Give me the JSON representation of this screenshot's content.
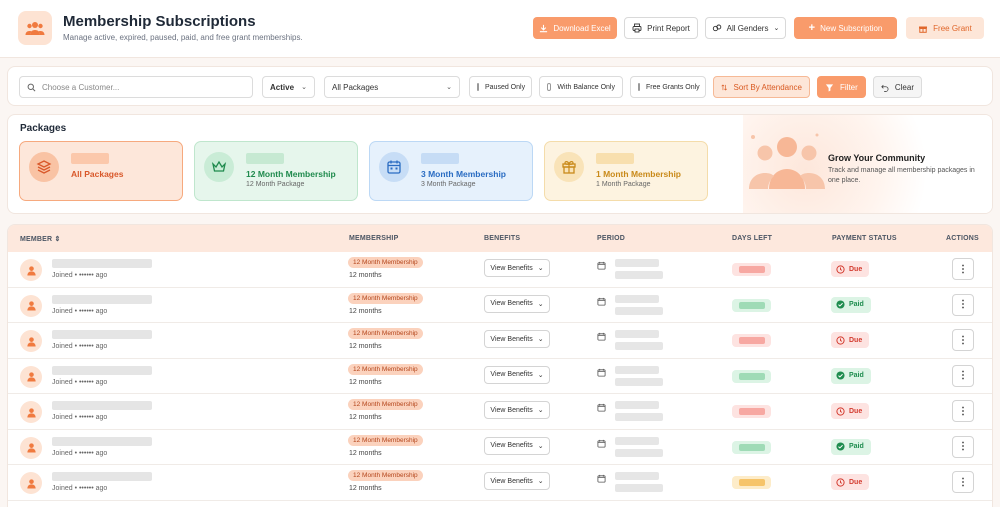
{
  "header": {
    "title": "Membership Subscriptions",
    "subtitle": "Manage active, expired, paused, paid, and free grant memberships.",
    "buttons": {
      "download_excel": "Download Excel",
      "print_report": "Print Report",
      "all_genders": "All Genders",
      "new_subscription": "New Subscription",
      "free_grant": "Free Grant"
    }
  },
  "filters": {
    "search_placeholder": "Choose a Customer...",
    "status_select": "Active",
    "package_select": "All Packages",
    "paused_only": "Paused Only",
    "with_balance_only": "With Balance Only",
    "free_grants_only": "Free Grants Only",
    "sort_by_attendance": "Sort By Attendance",
    "filter": "Filter",
    "clear": "Clear"
  },
  "packages": {
    "title": "Packages",
    "cards": [
      {
        "name": "All Packages",
        "sub": ""
      },
      {
        "name": "12 Month Membership",
        "sub": "12 Month Package"
      },
      {
        "name": "3 Month Membership",
        "sub": "3 Month Package"
      },
      {
        "name": "1 Month Membership",
        "sub": "1 Month Package"
      }
    ],
    "promo_title": "Grow Your Community",
    "promo_text": "Track and manage all membership packages in one place."
  },
  "table": {
    "headers": {
      "member": "MEMBER",
      "membership": "MEMBERSHIP",
      "benefits": "BENEFITS",
      "period": "PERIOD",
      "days_left": "DAYS LEFT",
      "payment_status": "PAYMENT STATUS",
      "actions": "ACTIONS"
    },
    "rows": [
      {
        "joined": "Joined • •••••• ago",
        "membership": "12 Month Membership",
        "duration": "12 months",
        "benefits": "View Benefits",
        "days_color": "red",
        "status": "Due"
      },
      {
        "joined": "Joined • •••••• ago",
        "membership": "12 Month Membership",
        "duration": "12 months",
        "benefits": "View Benefits",
        "days_color": "green",
        "status": "Paid"
      },
      {
        "joined": "Joined • •••••• ago",
        "membership": "12 Month Membership",
        "duration": "12 months",
        "benefits": "View Benefits",
        "days_color": "red",
        "status": "Due"
      },
      {
        "joined": "Joined • •••••• ago",
        "membership": "12 Month Membership",
        "duration": "12 months",
        "benefits": "View Benefits",
        "days_color": "green",
        "status": "Paid"
      },
      {
        "joined": "Joined • •••••• ago",
        "membership": "12 Month Membership",
        "duration": "12 months",
        "benefits": "View Benefits",
        "days_color": "red",
        "status": "Due"
      },
      {
        "joined": "Joined • •••••• ago",
        "membership": "12 Month Membership",
        "duration": "12 months",
        "benefits": "View Benefits",
        "days_color": "green",
        "status": "Paid"
      },
      {
        "joined": "Joined • •••••• ago",
        "membership": "12 Month Membership",
        "duration": "12 months",
        "benefits": "View Benefits",
        "days_color": "orange",
        "status": "Due"
      }
    ]
  },
  "colors": {
    "accent": "#f99b6b",
    "due": "#d33b2f",
    "paid": "#1e8c4e"
  }
}
